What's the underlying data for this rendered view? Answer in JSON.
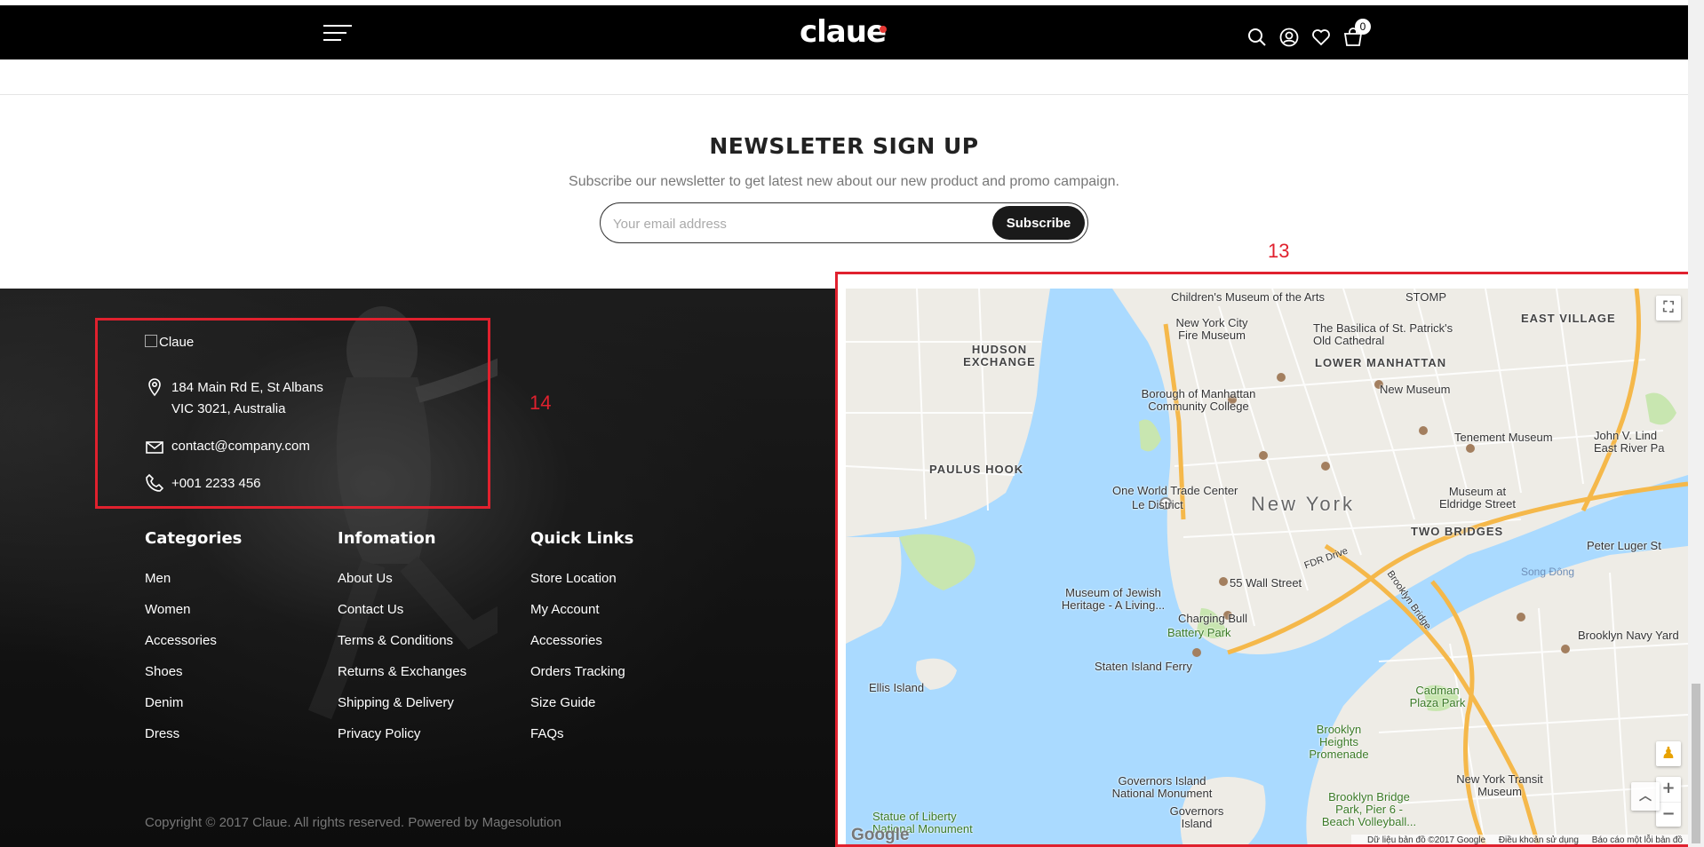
{
  "header": {
    "logo_text": "claue",
    "cart_count": "0",
    "icons": [
      "menu-icon",
      "search-icon",
      "user-icon",
      "heart-icon",
      "cart-icon"
    ]
  },
  "newsletter": {
    "title": "NEWSLETER SIGN UP",
    "subtitle": "Subscribe our newsletter to get latest new about our new product and promo campaign.",
    "email_placeholder": "Your email address",
    "button_label": "Subscribe"
  },
  "footer": {
    "logo_alt": "Claue",
    "address_line1": "184 Main Rd E, St Albans",
    "address_line2": "VIC 3021, Australia",
    "email": "contact@company.com",
    "phone": "+001 2233 456",
    "columns": [
      {
        "title": "Categories",
        "links": [
          "Men",
          "Women",
          "Accessories",
          "Shoes",
          "Denim",
          "Dress"
        ]
      },
      {
        "title": "Infomation",
        "links": [
          "About Us",
          "Contact Us",
          "Terms & Conditions",
          "Returns & Exchanges",
          "Shipping & Delivery",
          "Privacy Policy"
        ]
      },
      {
        "title": "Quick Links",
        "links": [
          "Store Location",
          "My Account",
          "Accessories",
          "Orders Tracking",
          "Size Guide",
          "FAQs"
        ]
      }
    ],
    "copyright": "Copyright © 2017 Claue. All rights reserved. Powered by Magesolution"
  },
  "annotations": {
    "box_13": "13",
    "box_14": "14",
    "color": "#e0212e"
  },
  "map": {
    "labels": {
      "childrens_museum": "Children's Museum of the Arts",
      "stomp": "STOMP",
      "east_village": "EAST VILLAGE",
      "basilica": "The Basilica of St. Patrick's Old Cathedral",
      "fire_museum": "New York City Fire Museum",
      "hudson_exchange": "HUDSON EXCHANGE",
      "lower_manhattan": "LOWER MANHATTAN",
      "bmcc": "Borough of Manhattan Community College",
      "new_museum": "New Museum",
      "tenement_museum": "Tenement Museum",
      "john_v_lind": "John V. Lind",
      "east_river_park": "East River Pa",
      "paulus_hook": "PAULUS HOOK",
      "wtc": "One World Trade Center",
      "le_district": "Le District",
      "new_york": "New York",
      "eldridge": "Museum at Eldridge Street",
      "two_bridges": "TWO BRIDGES",
      "peter_luger": "Peter Luger St",
      "jewish_heritage": "Museum of Jewish Heritage - A Living...",
      "wall_st": "55 Wall Street",
      "charging_bull": "Charging Bull",
      "battery_park": "Battery Park",
      "song_dong": "Song Đông",
      "staten_ferry": "Staten Island Ferry",
      "navy_yard": "Brooklyn Navy Yard",
      "ellis_island": "Ellis Island",
      "cadman": "Cadman Plaza Park",
      "brooklyn_heights": "Brooklyn Heights Promenade",
      "transit_museum": "New York Transit Museum",
      "governors_monument": "Governors Island National Monument",
      "governors": "Governors Island",
      "bridge_park": "Brooklyn Bridge Park, Pier 6 - Beach Volleyball...",
      "statue_liberty": "Statue of Liberty National Monument",
      "fdr_drive": "FDR Drive",
      "brooklyn_bridge": "Brooklyn Bridge"
    },
    "attribution": "Dữ liệu bản đồ ©2017 Google",
    "terms": "Điều khoản sử dụng",
    "report": "Báo cáo một lỗi bản đồ",
    "google": "Google"
  }
}
